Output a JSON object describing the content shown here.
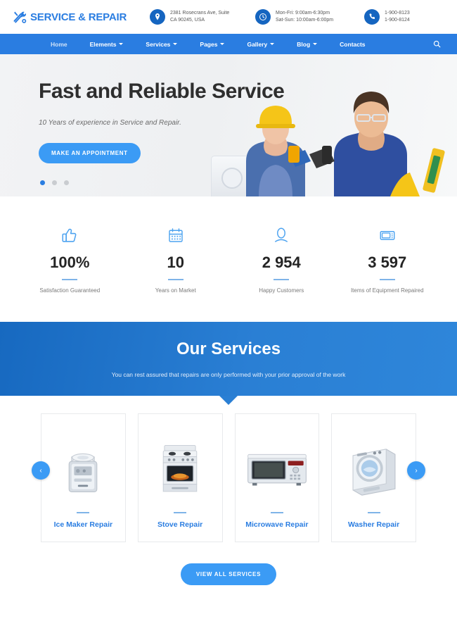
{
  "header": {
    "logo_text": "SERVICE & REPAIR",
    "logo_icon": "wrench-screwdriver-icon",
    "address": {
      "icon": "map-pin-icon",
      "line1": "2381 Rosecrans Ave, Suite",
      "line2": "CA 90245, USA"
    },
    "hours": {
      "icon": "clock-icon",
      "line1": "Mon-Fri: 9:00am-6:30pm",
      "line2": "Sat-Sun: 10:00am-6:00pm"
    },
    "phone": {
      "icon": "phone-icon",
      "line1": "1-900-8123",
      "line2": "1-900-8124"
    }
  },
  "nav": {
    "items": [
      {
        "label": "Home",
        "has_dropdown": false,
        "active": true
      },
      {
        "label": "Elements",
        "has_dropdown": true,
        "active": false
      },
      {
        "label": "Services",
        "has_dropdown": true,
        "active": false
      },
      {
        "label": "Pages",
        "has_dropdown": true,
        "active": false
      },
      {
        "label": "Gallery",
        "has_dropdown": true,
        "active": false
      },
      {
        "label": "Blog",
        "has_dropdown": true,
        "active": false
      },
      {
        "label": "Contacts",
        "has_dropdown": false,
        "active": false
      }
    ],
    "search_icon": "search-icon"
  },
  "hero": {
    "title": "Fast and Reliable Service",
    "subtitle": "10 Years of experience in Service and Repair.",
    "cta": "MAKE AN APPOINTMENT",
    "slides": 3,
    "active_slide": 1
  },
  "counters": [
    {
      "icon": "thumbs-up-icon",
      "value": "100%",
      "label": "Satisfaction Guaranteed"
    },
    {
      "icon": "calendar-icon",
      "value": "10",
      "label": "Years on Market"
    },
    {
      "icon": "person-icon",
      "value": "2 954",
      "label": "Happy Customers"
    },
    {
      "icon": "appliance-icon",
      "value": "3 597",
      "label": "Items of Equipment Repaired"
    }
  ],
  "services": {
    "title": "Our Services",
    "subtitle": "You can rest assured that repairs are only performed with your prior approval of the work",
    "cards": [
      {
        "title": "Ice Maker Repair",
        "image": "ice-maker-photo"
      },
      {
        "title": "Stove Repair",
        "image": "stove-photo"
      },
      {
        "title": "Microwave Repair",
        "image": "microwave-photo"
      },
      {
        "title": "Washer Repair",
        "image": "washer-photo"
      }
    ],
    "prev_label": "‹",
    "next_label": "›",
    "view_all": "VIEW ALL SERVICES"
  },
  "colors": {
    "brand_blue": "#2a7de1",
    "button_blue": "#3b9bf5",
    "band_blue": "#1769c0",
    "icon_blue": "#4da3f0",
    "dark_text": "#2e2e2e"
  }
}
